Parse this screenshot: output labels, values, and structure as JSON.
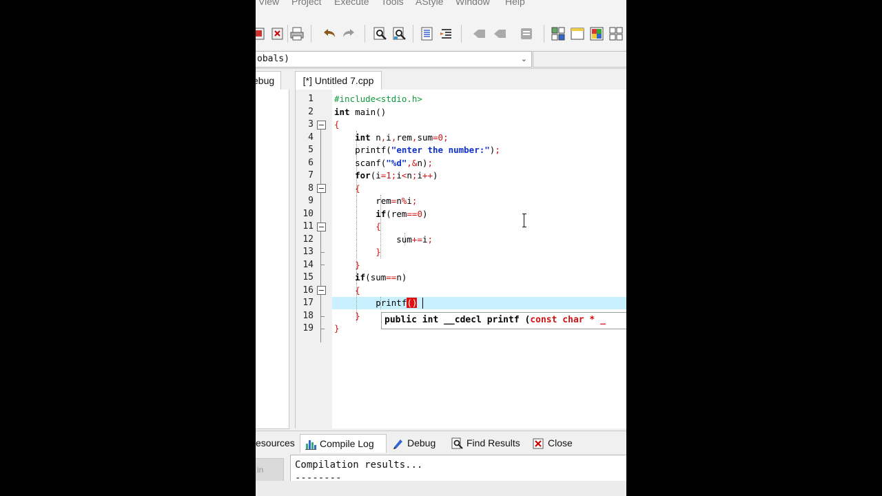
{
  "menu": {
    "items": [
      "View",
      "Project",
      "Execute",
      "Tools",
      "AStyle",
      "Window",
      "Help"
    ]
  },
  "toolbar": {
    "icons": [
      "close-all-icon",
      "print-icon",
      "undo-icon",
      "redo-icon",
      "find-icon",
      "replace-icon",
      "indent-icon",
      "unindent-icon",
      "bookmark-prev-icon",
      "bookmark-next-icon",
      "bookmark-icon",
      "new-project-icon",
      "window-icon",
      "colors-icon",
      "grid-icon"
    ]
  },
  "scope": {
    "value": "obals)"
  },
  "left_panel": {
    "tab_label": "ebug"
  },
  "editor": {
    "tab_label": "[*] Untitled 7.cpp",
    "line_numbers": [
      "1",
      "2",
      "3",
      "4",
      "5",
      "6",
      "7",
      "8",
      "9",
      "10",
      "11",
      "12",
      "13",
      "14",
      "15",
      "16",
      "17",
      "18",
      "19"
    ],
    "current_line": 17,
    "calltip": {
      "part1": "public int __cdecl printf (",
      "part2": "const char * _"
    }
  },
  "bottom_tabs": {
    "resources": "esources",
    "compile_log": "Compile Log",
    "debug": "Debug",
    "find_results": "Find Results",
    "close": "Close"
  },
  "bottom_panel": {
    "left_button": "in",
    "log_line1": "Compilation results...",
    "log_line2": "--------"
  },
  "colors": {
    "preprocessor": "#0c9a3a",
    "brace": "#d01010",
    "string": "#1030d0",
    "current_line_bg": "#c8f0ff"
  }
}
